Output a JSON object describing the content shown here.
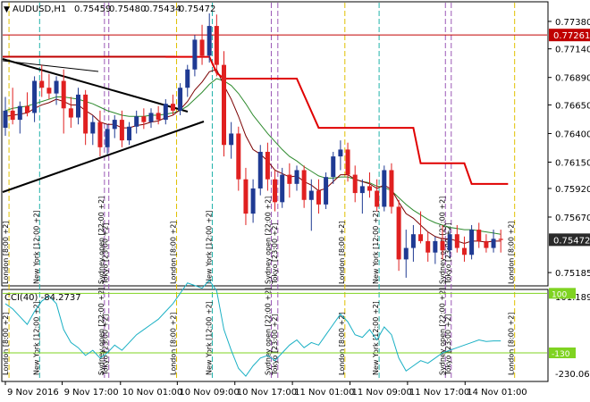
{
  "window": {
    "symbol_timeframe": "AUDUSD,H1",
    "ohlc": [
      "0.75459",
      "0.75480",
      "0.75434",
      "0.75472"
    ]
  },
  "colors": {
    "bull": "#1f3a93",
    "bear": "#e02020",
    "ma_fast": "#7a0000",
    "ma_slow": "#2e8b2e",
    "stop_line": "#e00000",
    "hline": "#c00000",
    "trendline": "#000000",
    "session_label_line": "#9b59b6",
    "london_line": "#e0c000",
    "newyork_line": "#20b2aa",
    "cci_line": "#1ab0c4",
    "cci_level_line": "#7fd321",
    "current_price_bg": "#2a2a2a",
    "hline_price_bg": "#c00000"
  },
  "price_axis": {
    "labels": [
      "0.77380",
      "0.77140",
      "0.76890",
      "0.76650",
      "0.76400",
      "0.76150",
      "0.75920",
      "0.75670",
      "0.75185"
    ],
    "hline_price": "0.77261",
    "current_price": "0.75472"
  },
  "cci": {
    "title": "CCI(40) -84.2737",
    "axis_labels": [
      "101.1893",
      "-230.0612"
    ],
    "level_labels": [
      "100",
      "-130"
    ]
  },
  "time_axis": {
    "labels": [
      "9 Nov 2016",
      "9 Nov 17:00",
      "10 Nov 01:00",
      "10 Nov 09:00",
      "10 Nov 17:00",
      "11 Nov 01:00",
      "11 Nov 09:00",
      "11 Nov 17:00",
      "14 Nov 01:00"
    ]
  },
  "sessions": [
    {
      "label": "London  [8:00 +2]"
    },
    {
      "label": "New York  [12:00 +2]"
    },
    {
      "label": "Sydney open  [22:00 +2]"
    },
    {
      "label": "Tokyo  [23:00 +2]"
    },
    {
      "label": "London  [8:00 +2]"
    },
    {
      "label": "New York  [12:00 +2]"
    },
    {
      "label": "Sydney open  [22:00 +2]"
    },
    {
      "label": "Tokyo  [23:00 +2]"
    },
    {
      "label": "London  [8:00 +2]"
    },
    {
      "label": "New York  [12:00 +2]"
    },
    {
      "label": "Sydney open  [22:00 +2]"
    },
    {
      "label": "Tokyo  [23:00 +2]"
    },
    {
      "label": "London  [8:00 +2]"
    }
  ],
  "chart_data": {
    "type": "candlestick",
    "symbol": "AUDUSD",
    "timeframe": "H1",
    "y_range": [
      0.751,
      0.7752
    ],
    "candles": [
      [
        0.7645,
        0.7672,
        0.7638,
        0.766
      ],
      [
        0.766,
        0.768,
        0.7648,
        0.7652
      ],
      [
        0.7652,
        0.7668,
        0.764,
        0.7664
      ],
      [
        0.7664,
        0.7676,
        0.7655,
        0.7658
      ],
      [
        0.7658,
        0.769,
        0.765,
        0.7686
      ],
      [
        0.7686,
        0.77,
        0.7672,
        0.768
      ],
      [
        0.768,
        0.7692,
        0.767,
        0.7675
      ],
      [
        0.7675,
        0.769,
        0.7665,
        0.7686
      ],
      [
        0.7686,
        0.7696,
        0.764,
        0.7662
      ],
      [
        0.7662,
        0.7672,
        0.7645,
        0.7654
      ],
      [
        0.7654,
        0.768,
        0.7648,
        0.7674
      ],
      [
        0.7674,
        0.7678,
        0.763,
        0.764
      ],
      [
        0.764,
        0.7656,
        0.763,
        0.765
      ],
      [
        0.765,
        0.766,
        0.762,
        0.7628
      ],
      [
        0.7628,
        0.7648,
        0.7622,
        0.7644
      ],
      [
        0.7644,
        0.7656,
        0.7636,
        0.7652
      ],
      [
        0.7652,
        0.766,
        0.7628,
        0.7634
      ],
      [
        0.7634,
        0.765,
        0.763,
        0.7646
      ],
      [
        0.7646,
        0.766,
        0.764,
        0.7655
      ],
      [
        0.7655,
        0.7662,
        0.7644,
        0.765
      ],
      [
        0.765,
        0.7662,
        0.7645,
        0.7658
      ],
      [
        0.7658,
        0.7664,
        0.7648,
        0.7652
      ],
      [
        0.7652,
        0.767,
        0.7648,
        0.7666
      ],
      [
        0.7666,
        0.7674,
        0.7656,
        0.766
      ],
      [
        0.766,
        0.7684,
        0.7656,
        0.768
      ],
      [
        0.768,
        0.77,
        0.7672,
        0.7696
      ],
      [
        0.7696,
        0.7726,
        0.769,
        0.7722
      ],
      [
        0.7722,
        0.7735,
        0.77,
        0.7708
      ],
      [
        0.7708,
        0.7745,
        0.7702,
        0.7734
      ],
      [
        0.7734,
        0.7744,
        0.769,
        0.77
      ],
      [
        0.77,
        0.7712,
        0.762,
        0.763
      ],
      [
        0.763,
        0.765,
        0.7618,
        0.764
      ],
      [
        0.764,
        0.7646,
        0.759,
        0.76
      ],
      [
        0.76,
        0.761,
        0.756,
        0.757
      ],
      [
        0.757,
        0.76,
        0.7562,
        0.7592
      ],
      [
        0.7592,
        0.763,
        0.7586,
        0.7624
      ],
      [
        0.7624,
        0.7632,
        0.759,
        0.76
      ],
      [
        0.76,
        0.7608,
        0.7572,
        0.758
      ],
      [
        0.758,
        0.761,
        0.7575,
        0.7604
      ],
      [
        0.7604,
        0.7614,
        0.7584,
        0.7596
      ],
      [
        0.7596,
        0.7612,
        0.759,
        0.7608
      ],
      [
        0.7608,
        0.7612,
        0.7575,
        0.7582
      ],
      [
        0.7582,
        0.76,
        0.7555,
        0.759
      ],
      [
        0.759,
        0.76,
        0.757,
        0.7578
      ],
      [
        0.7578,
        0.7606,
        0.7574,
        0.7602
      ],
      [
        0.7602,
        0.7624,
        0.7596,
        0.762
      ],
      [
        0.762,
        0.7634,
        0.7608,
        0.7626
      ],
      [
        0.7626,
        0.7632,
        0.7598,
        0.7604
      ],
      [
        0.7604,
        0.7612,
        0.758,
        0.7588
      ],
      [
        0.7588,
        0.76,
        0.757,
        0.7594
      ],
      [
        0.7594,
        0.7606,
        0.7584,
        0.759
      ],
      [
        0.759,
        0.76,
        0.7572,
        0.7576
      ],
      [
        0.7576,
        0.7612,
        0.7572,
        0.7608
      ],
      [
        0.7608,
        0.7614,
        0.757,
        0.7576
      ],
      [
        0.7576,
        0.7582,
        0.752,
        0.753
      ],
      [
        0.753,
        0.7556,
        0.7514,
        0.754
      ],
      [
        0.754,
        0.756,
        0.7528,
        0.7552
      ],
      [
        0.7552,
        0.7572,
        0.7544,
        0.7546
      ],
      [
        0.7546,
        0.7554,
        0.7528,
        0.7536
      ],
      [
        0.7536,
        0.755,
        0.7526,
        0.7546
      ],
      [
        0.7546,
        0.756,
        0.753,
        0.7538
      ],
      [
        0.7538,
        0.7556,
        0.7532,
        0.7552
      ],
      [
        0.7552,
        0.756,
        0.7536,
        0.754
      ],
      [
        0.754,
        0.755,
        0.7528,
        0.7534
      ],
      [
        0.7534,
        0.756,
        0.753,
        0.7556
      ],
      [
        0.7556,
        0.7562,
        0.754,
        0.7546
      ],
      [
        0.7546,
        0.7552,
        0.7536,
        0.754
      ],
      [
        0.754,
        0.7556,
        0.7536,
        0.7548
      ],
      [
        0.7548,
        0.7556,
        0.7536,
        0.7547
      ]
    ],
    "ma_fast": [
      0.7655,
      0.7656,
      0.7657,
      0.7658,
      0.7662,
      0.7665,
      0.7667,
      0.767,
      0.7668,
      0.7665,
      0.7665,
      0.766,
      0.7656,
      0.765,
      0.7648,
      0.7648,
      0.7645,
      0.7645,
      0.7647,
      0.7648,
      0.765,
      0.7651,
      0.7654,
      0.7656,
      0.7661,
      0.7668,
      0.7678,
      0.7685,
      0.7694,
      0.7696,
      0.7682,
      0.767,
      0.7655,
      0.7638,
      0.7626,
      0.7622,
      0.7616,
      0.7608,
      0.7605,
      0.7602,
      0.7603,
      0.7598,
      0.7595,
      0.759,
      0.7592,
      0.7598,
      0.7604,
      0.7604,
      0.76,
      0.7598,
      0.7596,
      0.7592,
      0.7595,
      0.7591,
      0.758,
      0.757,
      0.7566,
      0.756,
      0.7554,
      0.755,
      0.7548,
      0.7548,
      0.7546,
      0.7544,
      0.7546,
      0.7546,
      0.7545,
      0.7546,
      0.7546
    ],
    "ma_slow": [
      0.766,
      0.7662,
      0.7663,
      0.7664,
      0.7666,
      0.7668,
      0.767,
      0.7672,
      0.7672,
      0.7671,
      0.767,
      0.7668,
      0.7666,
      0.7663,
      0.766,
      0.7658,
      0.7656,
      0.7655,
      0.7655,
      0.7655,
      0.7656,
      0.7656,
      0.7657,
      0.7658,
      0.766,
      0.7664,
      0.767,
      0.7676,
      0.7683,
      0.7688,
      0.7686,
      0.7682,
      0.7675,
      0.7666,
      0.7656,
      0.7648,
      0.764,
      0.7633,
      0.7626,
      0.762,
      0.7616,
      0.7611,
      0.7607,
      0.7603,
      0.7601,
      0.7601,
      0.7602,
      0.7602,
      0.76,
      0.7598,
      0.7597,
      0.7594,
      0.7593,
      0.759,
      0.7584,
      0.7578,
      0.7573,
      0.7569,
      0.7565,
      0.7562,
      0.756,
      0.7558,
      0.7557,
      0.7556,
      0.7556,
      0.7555,
      0.7554,
      0.7553,
      0.7552
    ],
    "stop_line": [
      [
        22,
        0.7707
      ],
      [
        28,
        0.7707
      ],
      [
        29,
        0.7693
      ],
      [
        30,
        0.7688
      ],
      [
        40,
        0.7688
      ],
      [
        43,
        0.7645
      ],
      [
        56,
        0.7645
      ],
      [
        57,
        0.7614
      ],
      [
        63,
        0.7614
      ],
      [
        64,
        0.7596
      ],
      [
        69,
        0.7596
      ]
    ],
    "hline": 0.77261,
    "cci": [
      60,
      40,
      10,
      -20,
      30,
      70,
      90,
      60,
      -40,
      -90,
      -110,
      -140,
      -120,
      -150,
      -130,
      -100,
      -120,
      -90,
      -60,
      -40,
      -20,
      0,
      30,
      60,
      100,
      140,
      130,
      120,
      150,
      110,
      -40,
      -120,
      -190,
      -220,
      -180,
      -150,
      -140,
      -160,
      -130,
      -100,
      -80,
      -110,
      -90,
      -100,
      -60,
      -20,
      20,
      -10,
      -60,
      -70,
      -40,
      -80,
      -30,
      -60,
      -150,
      -200,
      -180,
      -160,
      -170,
      -150,
      -130,
      -120,
      -110,
      -100,
      -90,
      -80,
      -86,
      -84,
      -84
    ],
    "cci_range": [
      -230.0612,
      101.1893
    ],
    "cci_levels": [
      100,
      -130
    ]
  }
}
